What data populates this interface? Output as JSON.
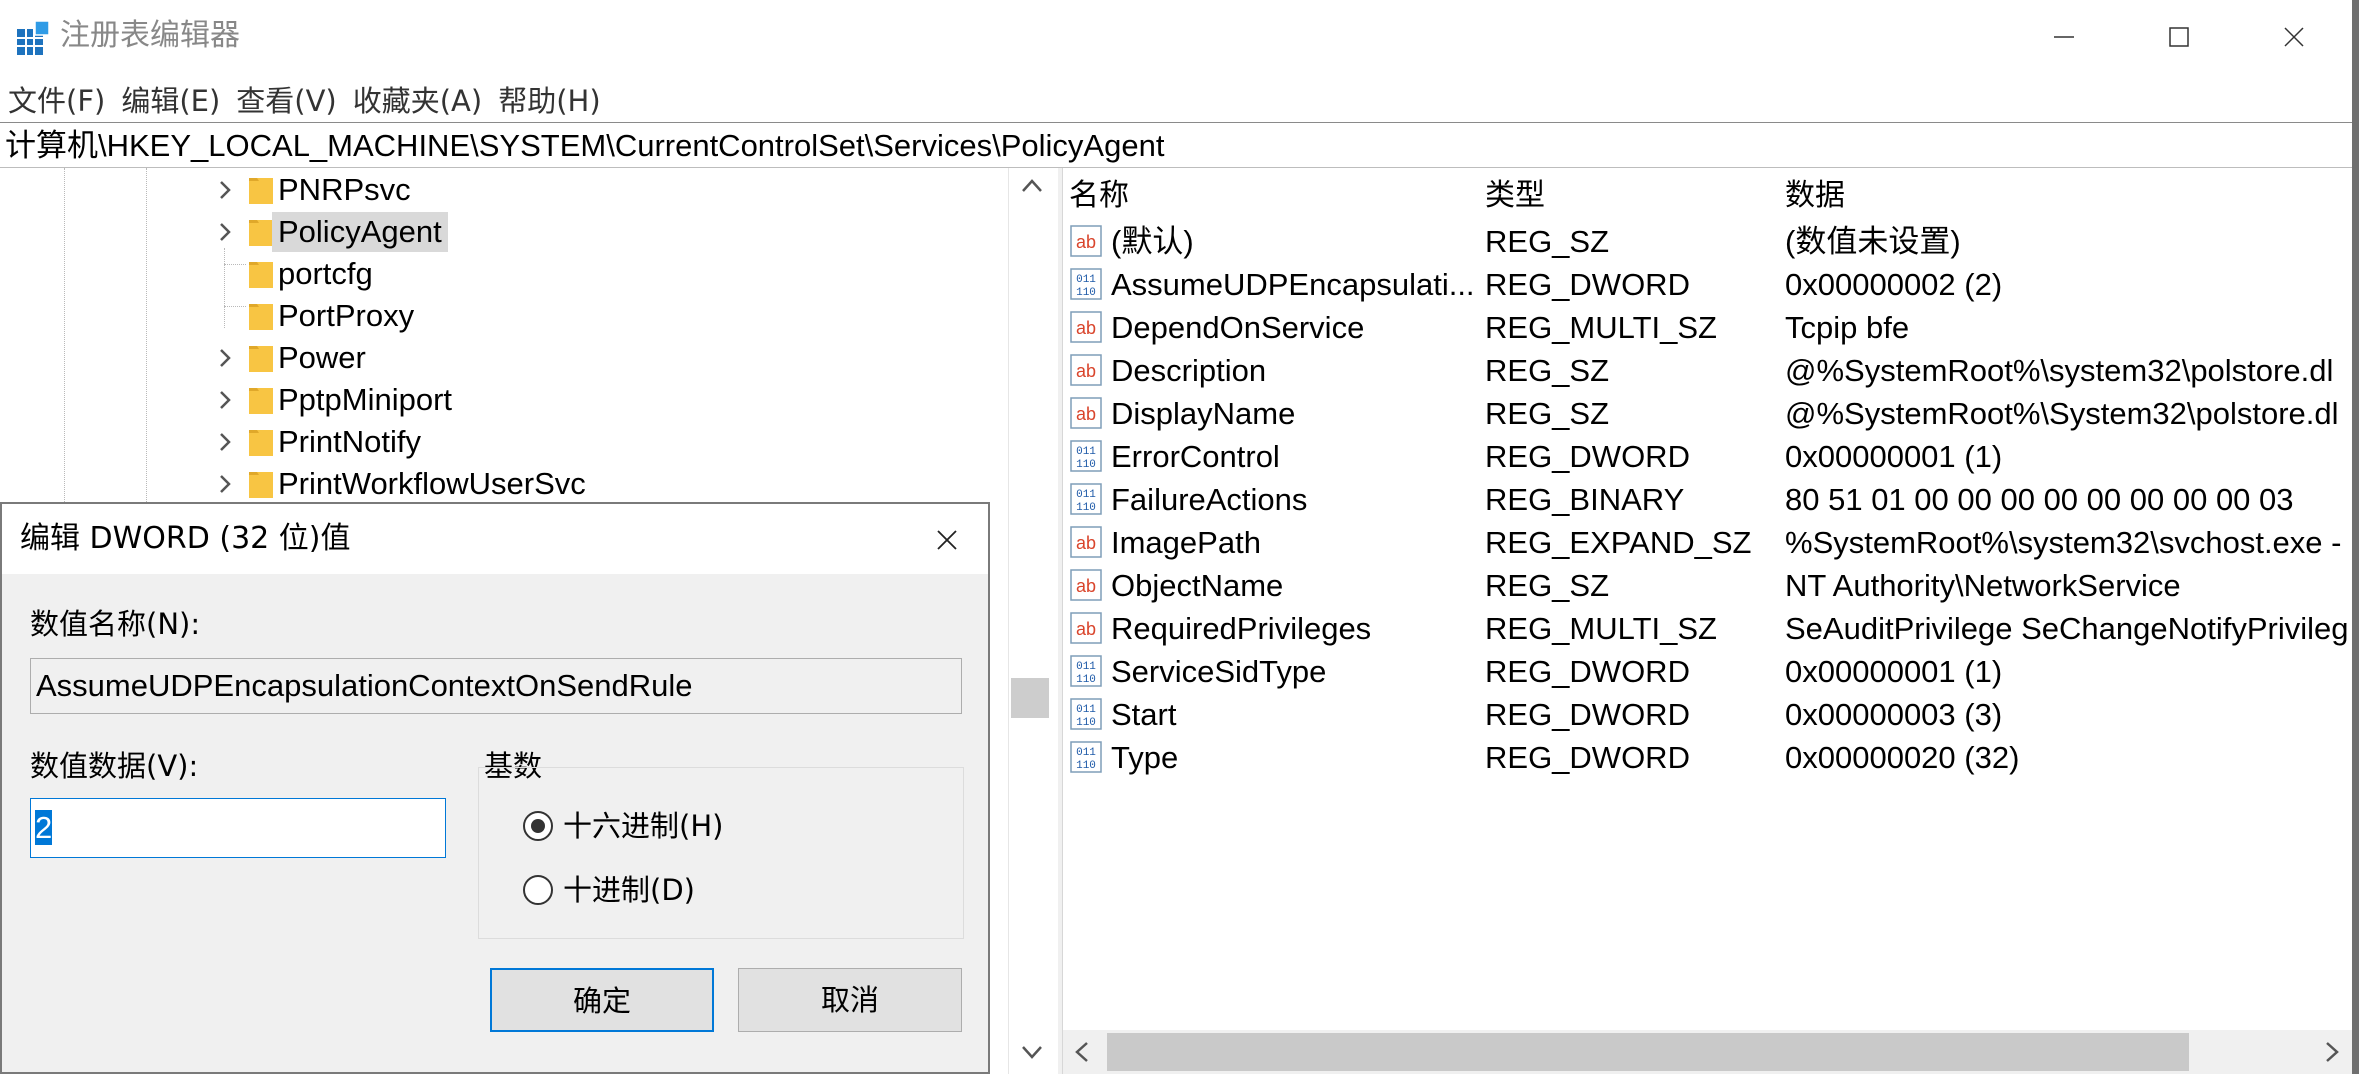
{
  "window": {
    "title": "注册表编辑器"
  },
  "menu": [
    "文件(F)",
    "编辑(E)",
    "查看(V)",
    "收藏夹(A)",
    "帮助(H)"
  ],
  "address": "计算机\\HKEY_LOCAL_MACHINE\\SYSTEM\\CurrentControlSet\\Services\\PolicyAgent",
  "tree": {
    "items": [
      {
        "label": "PNRPsvc",
        "expandable": true,
        "selected": false
      },
      {
        "label": "PolicyAgent",
        "expandable": true,
        "selected": true
      },
      {
        "label": "portcfg",
        "expandable": false,
        "selected": false
      },
      {
        "label": "PortProxy",
        "expandable": false,
        "selected": false
      },
      {
        "label": "Power",
        "expandable": true,
        "selected": false
      },
      {
        "label": "PptpMiniport",
        "expandable": true,
        "selected": false
      },
      {
        "label": "PrintNotify",
        "expandable": true,
        "selected": false
      },
      {
        "label": "PrintWorkflowUserSvc",
        "expandable": true,
        "selected": false
      }
    ]
  },
  "list": {
    "columns": [
      "名称",
      "类型",
      "数据"
    ],
    "rows": [
      {
        "icon": "string-value-icon",
        "name": "(默认)",
        "type": "REG_SZ",
        "data": "(数值未设置)"
      },
      {
        "icon": "binary-value-icon",
        "name": "AssumeUDPEncapsulati...",
        "type": "REG_DWORD",
        "data": "0x00000002 (2)"
      },
      {
        "icon": "string-value-icon",
        "name": "DependOnService",
        "type": "REG_MULTI_SZ",
        "data": "Tcpip bfe"
      },
      {
        "icon": "string-value-icon",
        "name": "Description",
        "type": "REG_SZ",
        "data": "@%SystemRoot%\\system32\\polstore.dl"
      },
      {
        "icon": "string-value-icon",
        "name": "DisplayName",
        "type": "REG_SZ",
        "data": "@%SystemRoot%\\System32\\polstore.dl"
      },
      {
        "icon": "binary-value-icon",
        "name": "ErrorControl",
        "type": "REG_DWORD",
        "data": "0x00000001 (1)"
      },
      {
        "icon": "binary-value-icon",
        "name": "FailureActions",
        "type": "REG_BINARY",
        "data": "80 51 01 00 00 00 00 00 00 00 00 03"
      },
      {
        "icon": "string-value-icon",
        "name": "ImagePath",
        "type": "REG_EXPAND_SZ",
        "data": "%SystemRoot%\\system32\\svchost.exe -"
      },
      {
        "icon": "string-value-icon",
        "name": "ObjectName",
        "type": "REG_SZ",
        "data": "NT Authority\\NetworkService"
      },
      {
        "icon": "string-value-icon",
        "name": "RequiredPrivileges",
        "type": "REG_MULTI_SZ",
        "data": "SeAuditPrivilege SeChangeNotifyPrivileg"
      },
      {
        "icon": "binary-value-icon",
        "name": "ServiceSidType",
        "type": "REG_DWORD",
        "data": "0x00000001 (1)"
      },
      {
        "icon": "binary-value-icon",
        "name": "Start",
        "type": "REG_DWORD",
        "data": "0x00000003 (3)"
      },
      {
        "icon": "binary-value-icon",
        "name": "Type",
        "type": "REG_DWORD",
        "data": "0x00000020 (32)"
      }
    ]
  },
  "dialog": {
    "title": "编辑 DWORD (32 位)值",
    "name_label": "数值名称(N):",
    "name_value": "AssumeUDPEncapsulationContextOnSendRule",
    "data_label": "数值数据(V):",
    "data_value": "2",
    "base_label": "基数",
    "radio_hex": "十六进制(H)",
    "radio_dec": "十进制(D)",
    "selected_base": "hex",
    "ok": "确定",
    "cancel": "取消"
  },
  "colors": {
    "accent": "#0078d7",
    "folder": "#f8c543",
    "selection": "#d9d9d9"
  }
}
